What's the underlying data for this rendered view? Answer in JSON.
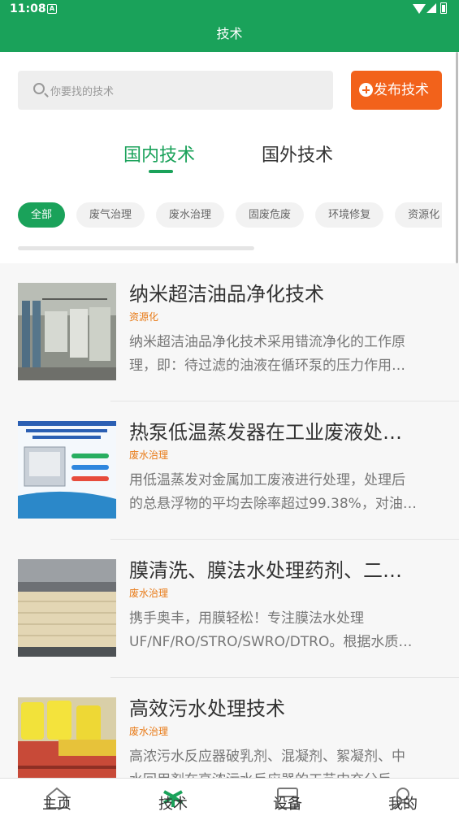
{
  "status_bar": {
    "time": "11:08",
    "notification_icon": "A"
  },
  "app_bar": {
    "title": "技术"
  },
  "search": {
    "placeholder": "你要找的技术"
  },
  "publish_button": {
    "label": "发布技术",
    "icon": "plus-circle-icon"
  },
  "tabs": [
    {
      "label": "国内技术",
      "active": true
    },
    {
      "label": "国外技术",
      "active": false
    }
  ],
  "categories": [
    {
      "label": "全部",
      "active": true
    },
    {
      "label": "废气治理",
      "active": false
    },
    {
      "label": "废水治理",
      "active": false
    },
    {
      "label": "固废危废",
      "active": false
    },
    {
      "label": "环境修复",
      "active": false
    },
    {
      "label": "资源化",
      "active": false
    }
  ],
  "items": [
    {
      "title": "纳米超洁油品净化技术",
      "tag": "资源化",
      "desc_line1": "纳米超洁油品净化技术采用错流净化的工作原",
      "desc_line2": "理，即：待过滤的油液在循环泵的压力作用…"
    },
    {
      "title": "热泵低温蒸发器在工业废液处…",
      "tag": "废水治理",
      "desc_line1": "用低温蒸发对金属加工废液进行处理，处理后",
      "desc_line2": "的总悬浮物的平均去除率超过99.38%，对油…"
    },
    {
      "title": "膜清洗、膜法水处理药剂、二…",
      "tag": "废水治理",
      "desc_line1": "携手奥丰，用膜轻松！专注膜法水处理",
      "desc_line2": "UF/NF/RO/STRO/SWRO/DTRO。根据水质…"
    },
    {
      "title": "高效污水处理技术",
      "tag": "废水治理",
      "desc_line1": "高浓污水反应器破乳剂、混凝剂、絮凝剂、中",
      "desc_line2": "水回用剂在高浓污水反应器的工艺中充分反…"
    }
  ],
  "bottom_nav": [
    {
      "label": "主页",
      "icon": "home-icon",
      "active": false
    },
    {
      "label": "技术",
      "icon": "tech-icon",
      "active": true
    },
    {
      "label": "设备",
      "icon": "device-icon",
      "active": false
    },
    {
      "label": "我的",
      "icon": "profile-icon",
      "active": false
    }
  ],
  "colors": {
    "primary": "#1aa25a",
    "accent": "#f2621b",
    "tag": "#e87a16"
  }
}
